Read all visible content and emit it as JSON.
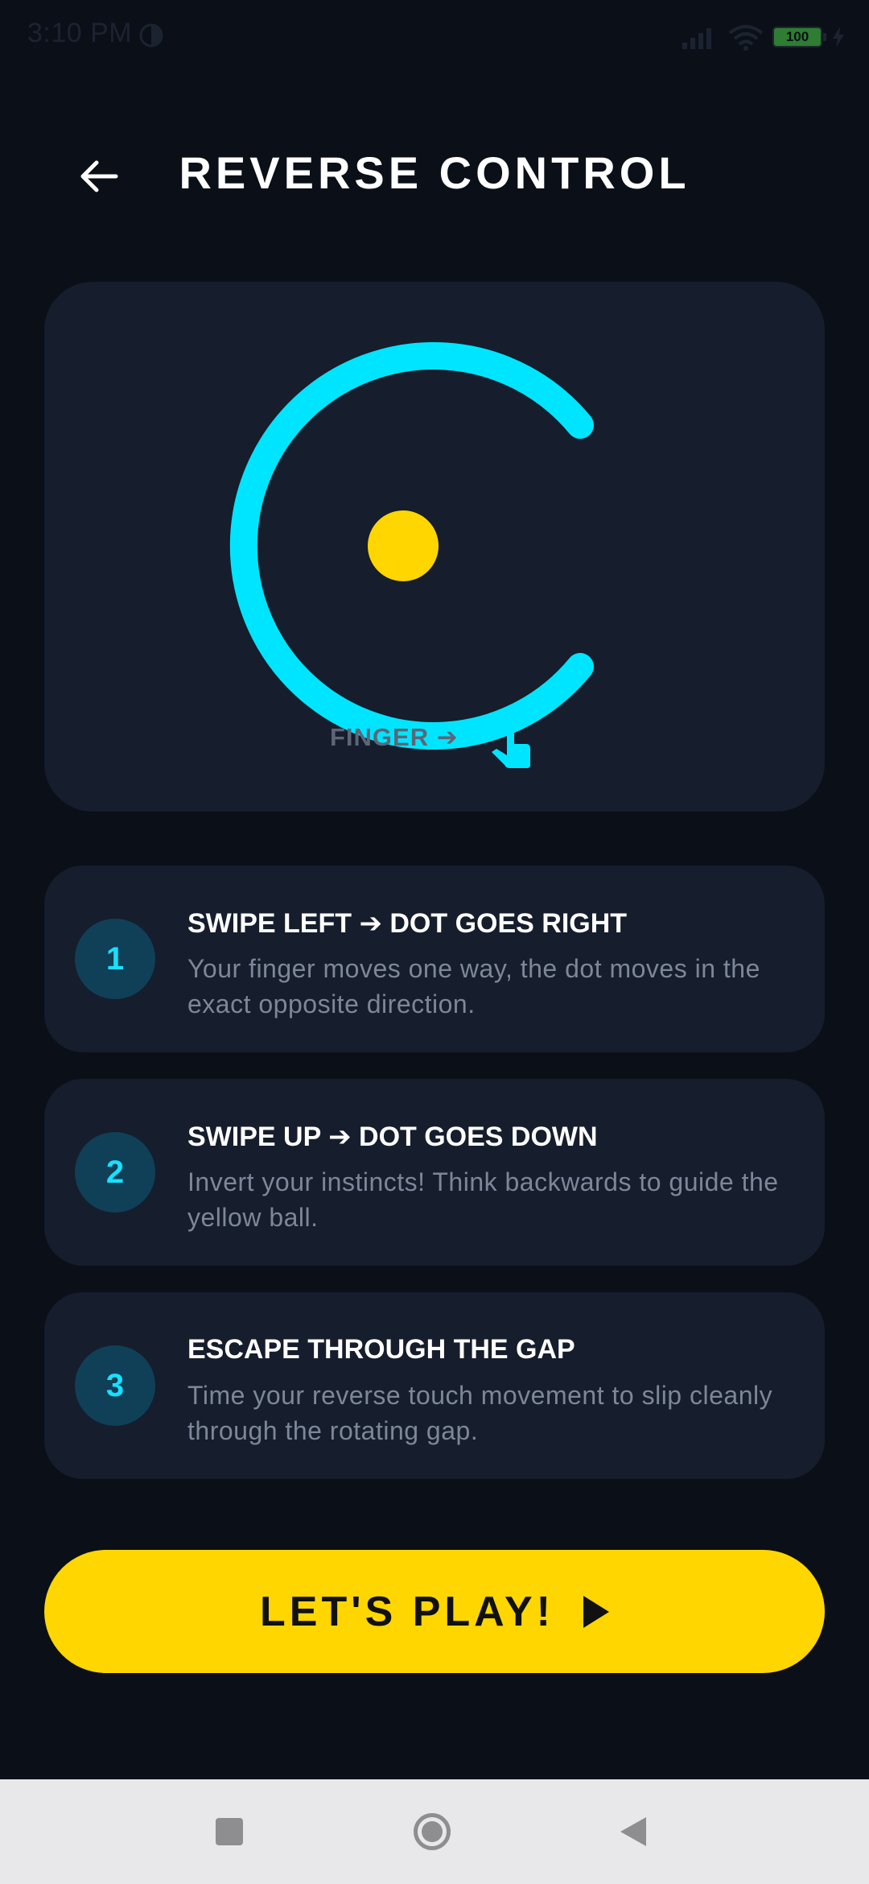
{
  "status_bar": {
    "time": "3:10 PM",
    "battery_level": "100"
  },
  "header": {
    "title": "REVERSE CONTROL",
    "back_icon": "arrow-left-icon"
  },
  "demo": {
    "finger_label": "FINGER ➔",
    "ring_color": "#00e5ff",
    "ball_color": "#ffd600"
  },
  "steps": [
    {
      "number": "1",
      "title": "SWIPE LEFT ➔ DOT GOES RIGHT",
      "description": "Your finger moves one way, the dot moves in the exact opposite direction."
    },
    {
      "number": "2",
      "title": "SWIPE UP ➔ DOT GOES DOWN",
      "description": "Invert your instincts! Think backwards to guide the yellow ball."
    },
    {
      "number": "3",
      "title": "ESCAPE THROUGH THE GAP",
      "description": "Time your reverse touch movement to slip cleanly through the rotating gap."
    }
  ],
  "play_button": {
    "label": "LET'S PLAY!",
    "icon": "play-icon"
  },
  "colors": {
    "background": "#0b0f18",
    "card": "#161d2c",
    "accent_cyan": "#18e0ff",
    "accent_yellow": "#ffd600"
  }
}
